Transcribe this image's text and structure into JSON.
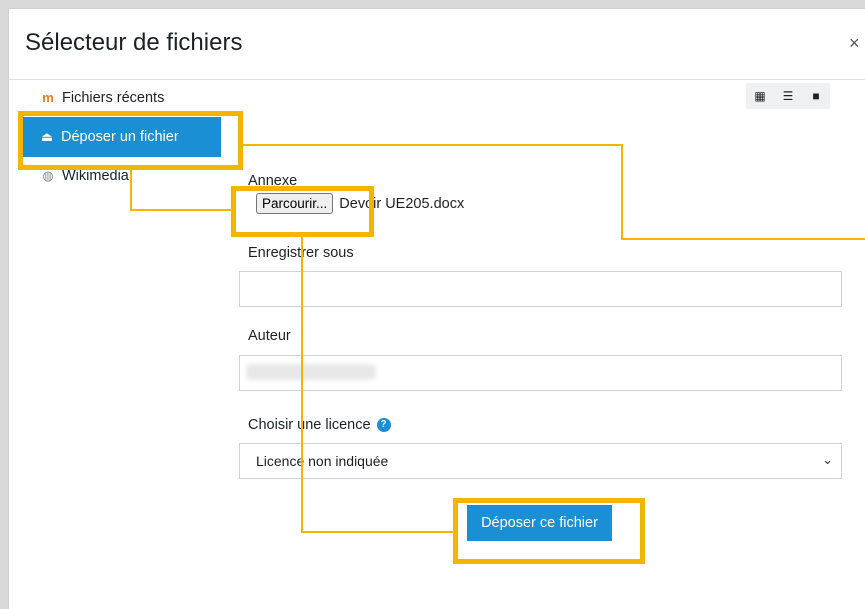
{
  "dialog": {
    "title": "Sélecteur de fichiers",
    "close": "×"
  },
  "repositories": [
    {
      "label": "Fichiers récents",
      "icon": "moodle-icon"
    },
    {
      "label": "Déposer un fichier",
      "icon": "upload-icon"
    },
    {
      "label": "Wikimedia",
      "icon": "wikimedia-icon"
    }
  ],
  "view_buttons": [
    "grid-view-icon",
    "list-view-icon",
    "folder-view-icon"
  ],
  "form": {
    "attachment_label": "Annexe",
    "browse_label": "Parcourir...",
    "file_name": "Devoir UE205.docx",
    "save_as_label": "Enregistrer sous",
    "save_as_value": "",
    "author_label": "Auteur",
    "license_label": "Choisir une licence",
    "license_value": "Licence non indiquée",
    "submit_label": "Déposer ce fichier"
  },
  "colors": {
    "accent": "#1a8fd3",
    "highlight": "#f5b400"
  }
}
